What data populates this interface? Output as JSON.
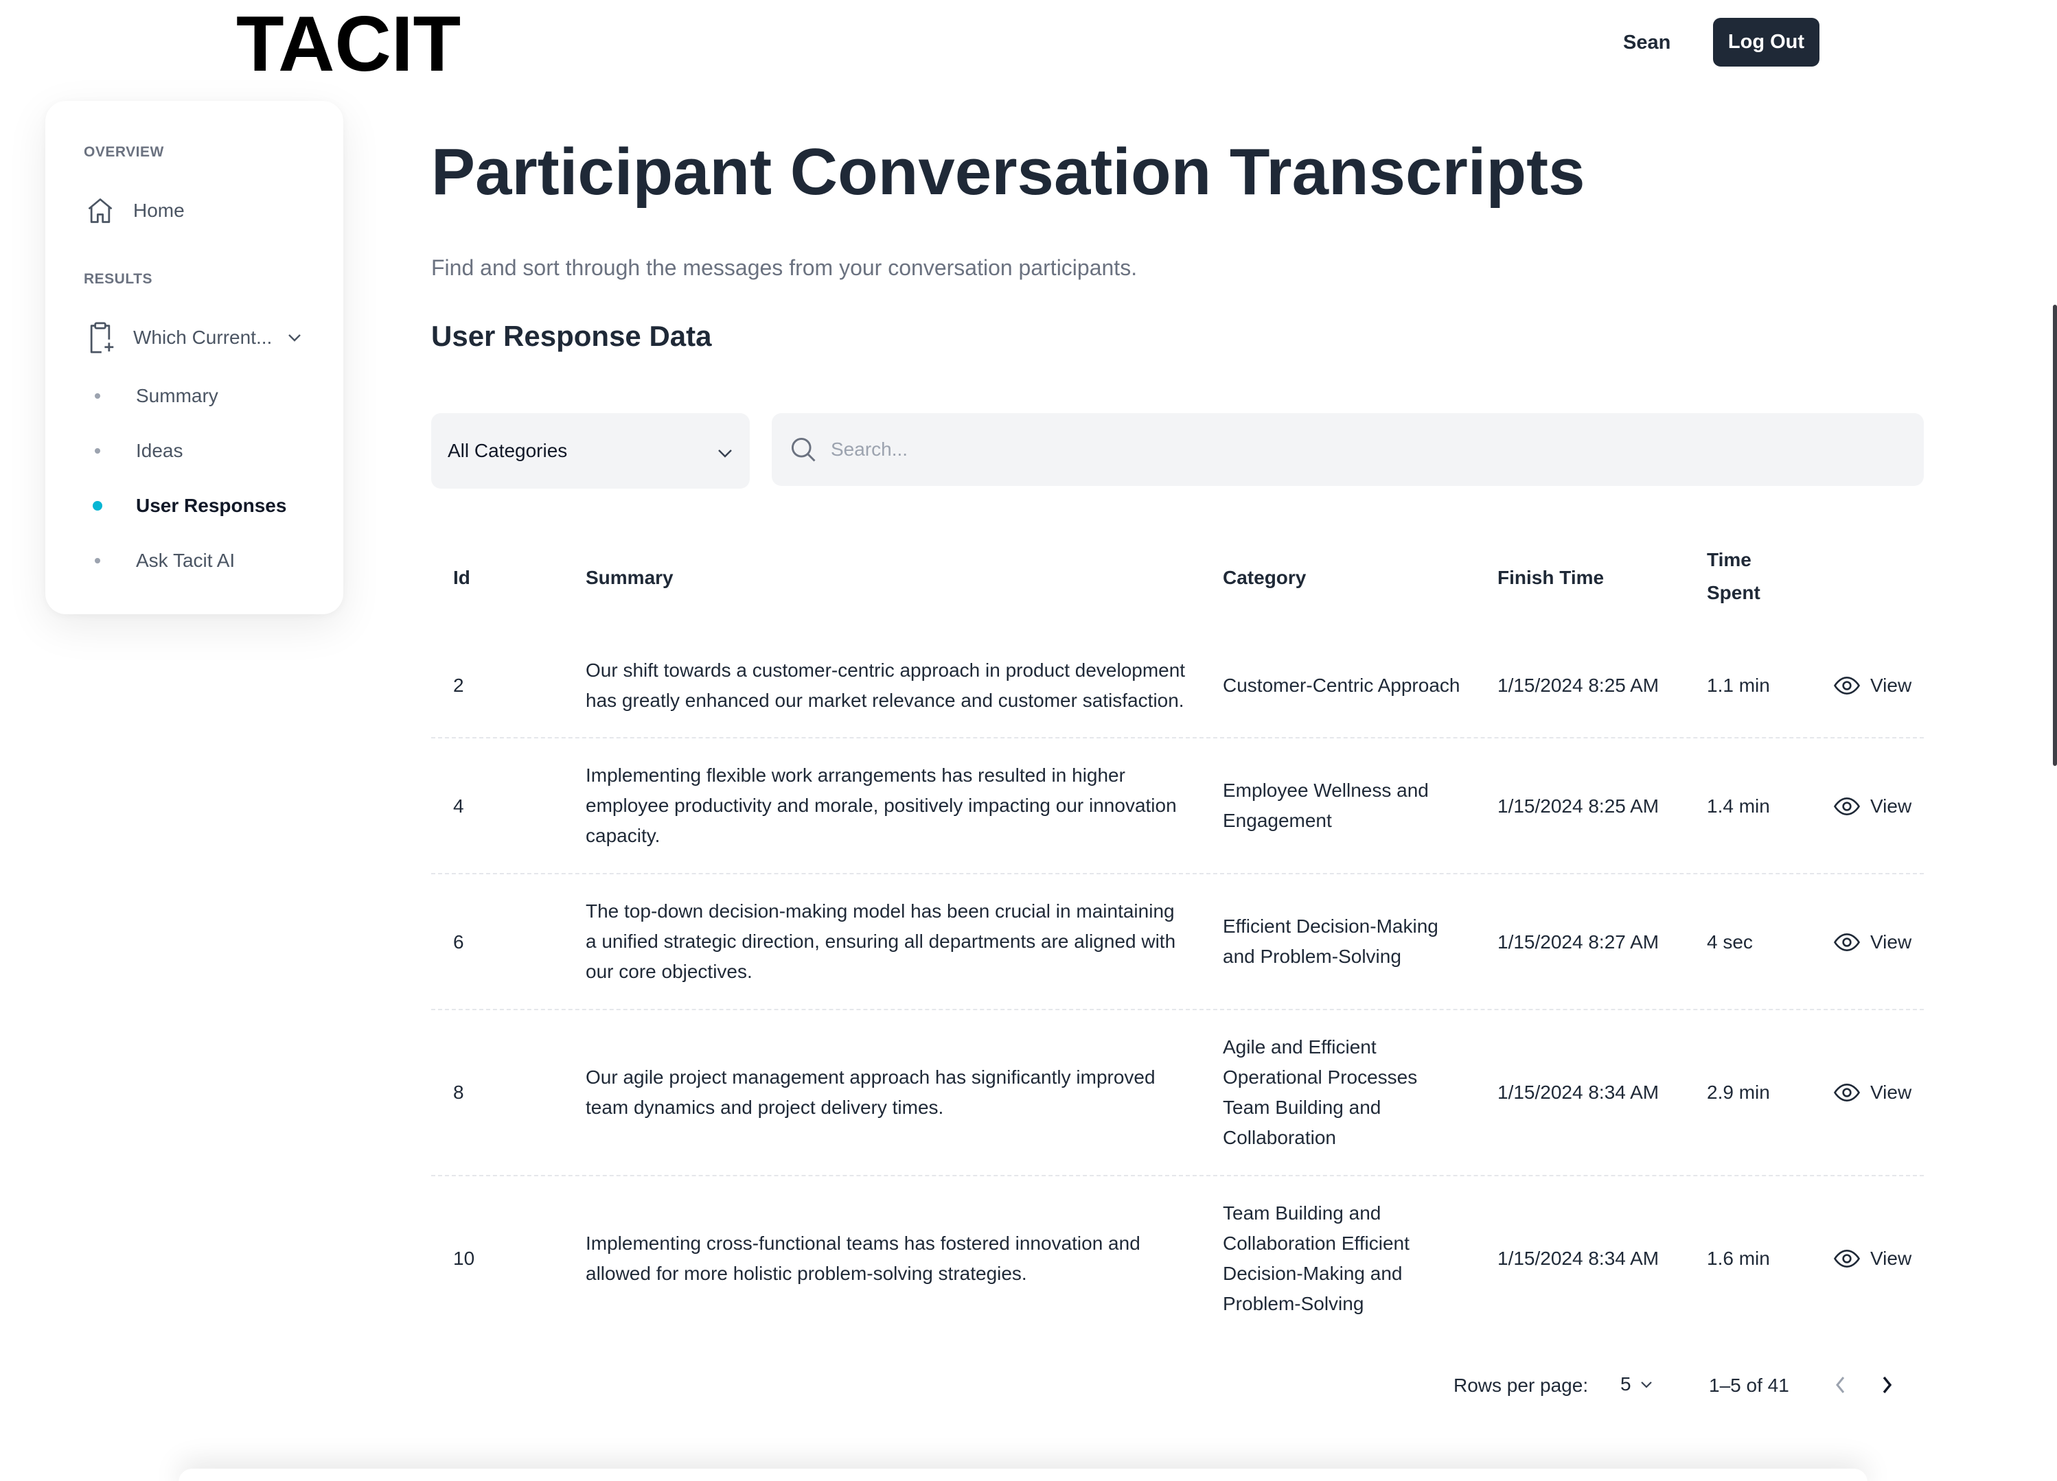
{
  "header": {
    "logo": "TACIT",
    "user_name": "Sean",
    "logout_label": "Log Out"
  },
  "sidebar": {
    "overview_label": "OVERVIEW",
    "home_label": "Home",
    "results_label": "RESULTS",
    "project_label": "Which Current...",
    "sub_items": [
      "Summary",
      "Ideas",
      "User Responses",
      "Ask Tacit AI"
    ],
    "active_item": "User Responses",
    "accent_color": "#06b6d4"
  },
  "main": {
    "title": "Participant Conversation Transcripts",
    "subtitle": "Find and sort through the messages from your conversation participants.",
    "section_title": "User Response Data",
    "category_filter": "All Categories",
    "search_placeholder": "Search..."
  },
  "table": {
    "columns": {
      "id": "Id",
      "summary": "Summary",
      "category": "Category",
      "finish_time": "Finish Time",
      "time_spent_1": "Time",
      "time_spent_2": "Spent"
    },
    "view_label": "View",
    "rows": [
      {
        "id": "2",
        "summary": "Our shift towards a customer-centric approach in product development has greatly enhanced our market relevance and customer satisfaction.",
        "category": "Customer-Centric Approach",
        "finish_time": "1/15/2024 8:25 AM",
        "time_spent": "1.1 min"
      },
      {
        "id": "4",
        "summary": "Implementing flexible work arrangements has resulted in higher employee productivity and morale, positively impacting our innovation capacity.",
        "category": "Employee Wellness and Engagement",
        "finish_time": "1/15/2024 8:25 AM",
        "time_spent": "1.4 min"
      },
      {
        "id": "6",
        "summary": "The top-down decision-making model has been crucial in maintaining a unified strategic direction, ensuring all departments are aligned with our core objectives.",
        "category": "Efficient Decision-Making and Problem-Solving",
        "finish_time": "1/15/2024 8:27 AM",
        "time_spent": "4 sec"
      },
      {
        "id": "8",
        "summary": "Our agile project management approach has significantly improved team dynamics and project delivery times.",
        "category": "Agile and Efficient Operational Processes Team Building and Collaboration",
        "finish_time": "1/15/2024 8:34 AM",
        "time_spent": "2.9 min"
      },
      {
        "id": "10",
        "summary": "Implementing cross-functional teams has fostered innovation and allowed for more holistic problem-solving strategies.",
        "category": "Team Building and Collaboration Efficient Decision-Making and Problem-Solving",
        "finish_time": "1/15/2024 8:34 AM",
        "time_spent": "1.6 min"
      }
    ]
  },
  "pagination": {
    "rows_per_page_label": "Rows per page:",
    "rows_per_page": "5",
    "range": "1–5 of 41"
  }
}
